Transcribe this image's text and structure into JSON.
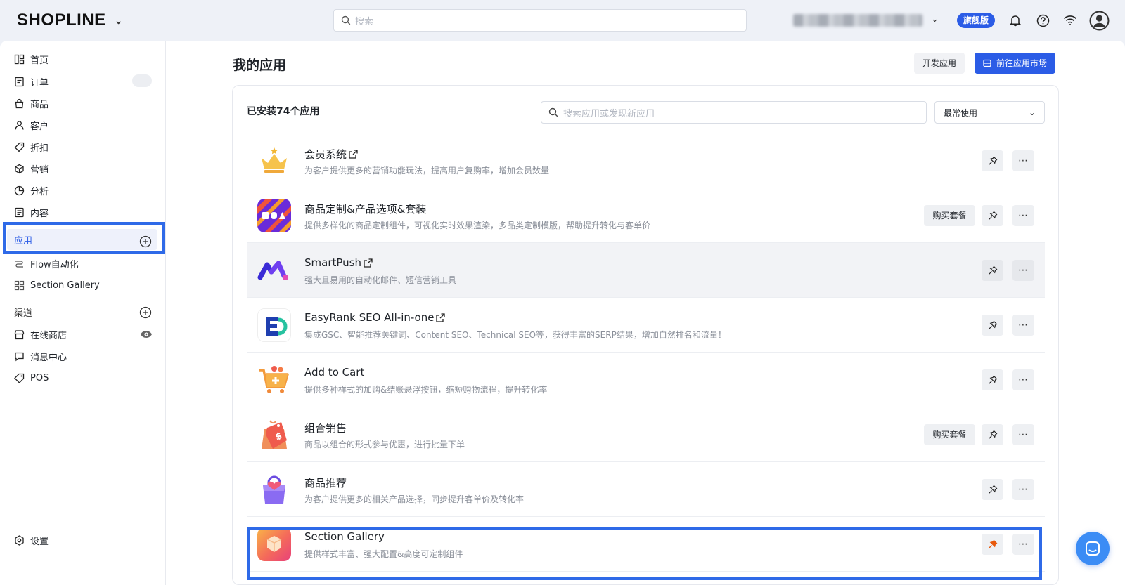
{
  "brand": {
    "logo_text": "SHOPLINE"
  },
  "topbar": {
    "search_placeholder": "搜索",
    "plan_badge": "旗舰版",
    "icons": [
      "bell-icon",
      "help-icon",
      "wifi-icon",
      "user-avatar-icon"
    ]
  },
  "sidebar": {
    "items": [
      {
        "label": "首页",
        "icon": "home-grid-icon"
      },
      {
        "label": "订单",
        "icon": "order-doc-icon"
      },
      {
        "label": "商品",
        "icon": "bag-icon"
      },
      {
        "label": "客户",
        "icon": "person-icon"
      },
      {
        "label": "折扣",
        "icon": "tag-icon"
      },
      {
        "label": "营销",
        "icon": "cube-icon"
      },
      {
        "label": "分析",
        "icon": "pie-icon"
      },
      {
        "label": "内容",
        "icon": "content-doc-icon"
      }
    ],
    "apps_label": "应用",
    "apps_sub": [
      {
        "label": "Flow自动化",
        "icon": "flow-icon"
      },
      {
        "label": "Section Gallery",
        "icon": "grid-icon"
      }
    ],
    "channels_label": "渠道",
    "channels": [
      {
        "label": "在线商店",
        "icon": "store-icon"
      },
      {
        "label": "消息中心",
        "icon": "chat-icon"
      },
      {
        "label": "POS",
        "icon": "pos-tag-icon"
      }
    ],
    "settings_label": "设置"
  },
  "main": {
    "title": "我的应用",
    "dev_button": "开发应用",
    "market_button": "前往应用市场",
    "installed_text": "已安装74个应用",
    "search_placeholder": "搜索应用或发现新应用",
    "sort_value": "最常使用",
    "buy_label": "购买套餐",
    "apps": [
      {
        "name": "会员系统",
        "desc": "为客户提供更多的营销功能玩法，提高用户复购率，增加会员数量",
        "external": true,
        "buy": false,
        "pinned": false
      },
      {
        "name": "商品定制&产品选项&套装",
        "desc": "提供多样化的商品定制组件，可视化实时效果渲染，多品类定制模版，帮助提升转化与客单价",
        "external": false,
        "buy": true,
        "pinned": false
      },
      {
        "name": "SmartPush",
        "desc": "强大且易用的自动化邮件、短信营销工具",
        "external": true,
        "buy": false,
        "pinned": false
      },
      {
        "name": "EasyRank SEO All-in-one",
        "desc": "集成GSC、智能推荐关键词、Content SEO、Technical SEO等，获得丰富的SERP结果，增加自然排名和流量！",
        "external": true,
        "buy": false,
        "pinned": false
      },
      {
        "name": "Add to Cart",
        "desc": "提供多种样式的加购&结账悬浮按钮，缩短购物流程，提升转化率",
        "external": false,
        "buy": false,
        "pinned": false
      },
      {
        "name": "组合销售",
        "desc": "商品以组合的形式参与优惠，进行批量下单",
        "external": false,
        "buy": true,
        "pinned": false
      },
      {
        "name": "商品推荐",
        "desc": "为客户提供更多的相关产品选择，同步提升客单价及转化率",
        "external": false,
        "buy": false,
        "pinned": false
      },
      {
        "name": "Section Gallery",
        "desc": "提供样式丰富、强大配置&高度可定制组件",
        "external": false,
        "buy": false,
        "pinned": true
      }
    ]
  },
  "colors": {
    "accent": "#2b5ce6",
    "highlight": "#2f6ae8",
    "pinned": "#e8590c"
  }
}
